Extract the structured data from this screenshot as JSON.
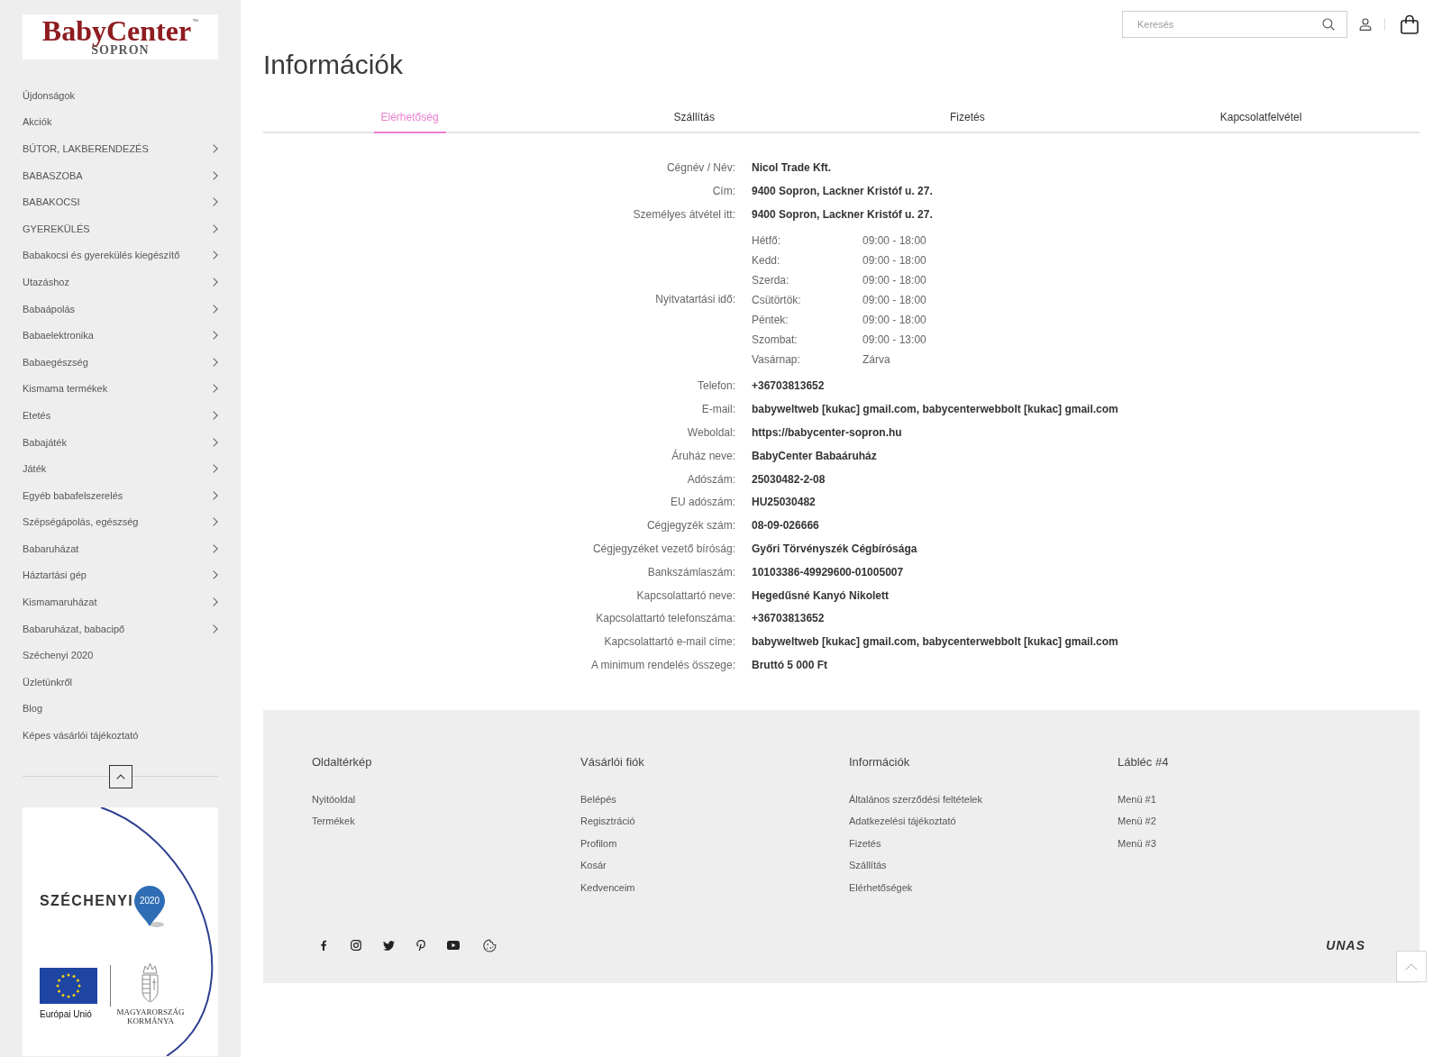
{
  "logo": {
    "brand": "BabyCenter",
    "trademark": "™",
    "city": "SOPRON"
  },
  "sidebar": {
    "items": [
      {
        "label": "Újdonságok",
        "submenu": false
      },
      {
        "label": "Akciók",
        "submenu": false
      },
      {
        "label": "BÚTOR, LAKBERENDEZÉS",
        "submenu": true
      },
      {
        "label": "BABASZOBA",
        "submenu": true
      },
      {
        "label": "BABAKOCSI",
        "submenu": true
      },
      {
        "label": "GYEREKÜLÉS",
        "submenu": true
      },
      {
        "label": "Babakocsi és gyerekülés kiegészítő",
        "submenu": true
      },
      {
        "label": "Utazáshoz",
        "submenu": true
      },
      {
        "label": "Babaápolás",
        "submenu": true
      },
      {
        "label": "Babaelektronika",
        "submenu": true
      },
      {
        "label": "Babaegészség",
        "submenu": true
      },
      {
        "label": "Kismama termékek",
        "submenu": true
      },
      {
        "label": "Etetés",
        "submenu": true
      },
      {
        "label": "Babajáték",
        "submenu": true
      },
      {
        "label": "Játék",
        "submenu": true
      },
      {
        "label": "Egyéb babafelszerelés",
        "submenu": true
      },
      {
        "label": "Szépségápolás, egészség",
        "submenu": true
      },
      {
        "label": "Babaruházat",
        "submenu": true
      },
      {
        "label": "Háztartási gép",
        "submenu": true
      },
      {
        "label": "Kismamaruházat",
        "submenu": true
      },
      {
        "label": "Babaruházat, babacipő",
        "submenu": true
      },
      {
        "label": "Széchenyi 2020",
        "submenu": false
      },
      {
        "label": "Üzletünkről",
        "submenu": false
      },
      {
        "label": "Blog",
        "submenu": false
      },
      {
        "label": "Képes vásárlói tájékoztató",
        "submenu": false
      }
    ]
  },
  "banner": {
    "title": "SZÉCHENYI",
    "year": "2020",
    "eu_label": "Európai Unió",
    "government_label": [
      "MAGYARORSZÁG",
      "KORMÁNYA"
    ]
  },
  "header": {
    "search": {
      "placeholder": "Keresés"
    }
  },
  "page_title": "Információk",
  "tabs": [
    {
      "label": "Elérhetőség",
      "selected": true
    },
    {
      "label": "Szállítás",
      "selected": false
    },
    {
      "label": "Fizetés",
      "selected": false
    },
    {
      "label": "Kapcsolatfelvétel",
      "selected": false
    }
  ],
  "info_rows": [
    {
      "kind": "text",
      "label": "Cégnév / Név:",
      "value": "Nicol Trade Kft."
    },
    {
      "kind": "text",
      "label": "Cím:",
      "value": "9400 Sopron, Lackner Kristóf u. 27."
    },
    {
      "kind": "text",
      "label": "Személyes átvétel itt:",
      "value": "9400 Sopron, Lackner Kristóf u. 27."
    },
    {
      "kind": "hours",
      "label": "Nyitvatartási idő:",
      "hours": [
        {
          "day": "Hétfő:",
          "time": "09:00 - 18:00"
        },
        {
          "day": "Kedd:",
          "time": "09:00 - 18:00"
        },
        {
          "day": "Szerda:",
          "time": "09:00 - 18:00"
        },
        {
          "day": "Csütörtök:",
          "time": "09:00 - 18:00"
        },
        {
          "day": "Péntek:",
          "time": "09:00 - 18:00"
        },
        {
          "day": "Szombat:",
          "time": "09:00 - 13:00"
        },
        {
          "day": "Vasárnap:",
          "time": "Zárva"
        }
      ]
    },
    {
      "kind": "text",
      "label": "Telefon:",
      "value": "+36703813652"
    },
    {
      "kind": "text",
      "label": "E-mail:",
      "value": "babyweltweb [kukac] gmail.com, babycenterwebbolt [kukac] gmail.com"
    },
    {
      "kind": "text",
      "label": "Weboldal:",
      "value": "https://babycenter-sopron.hu"
    },
    {
      "kind": "text",
      "label": "Áruház neve:",
      "value": "BabyCenter Babaáruház"
    },
    {
      "kind": "text",
      "label": "Adószám:",
      "value": "25030482-2-08"
    },
    {
      "kind": "text",
      "label": "EU adószám:",
      "value": "HU25030482"
    },
    {
      "kind": "text",
      "label": "Cégjegyzék szám:",
      "value": "08-09-026666"
    },
    {
      "kind": "text",
      "label": "Cégjegyzéket vezető bíróság:",
      "value": "Győri Törvényszék Cégbírósága"
    },
    {
      "kind": "text",
      "label": "Bankszámlaszám:",
      "value": "10103386-49929600-01005007"
    },
    {
      "kind": "text",
      "label": "Kapcsolattartó neve:",
      "value": "Hegedűsné Kanyó Nikolett"
    },
    {
      "kind": "text",
      "label": "Kapcsolattartó telefonszáma:",
      "value": "+36703813652"
    },
    {
      "kind": "text",
      "label": "Kapcsolattartó e-mail címe:",
      "value": "babyweltweb [kukac] gmail.com, babycenterwebbolt [kukac] gmail.com"
    },
    {
      "kind": "text",
      "label": "A minimum rendelés összege:",
      "value": "Bruttó 5 000 Ft"
    }
  ],
  "footer": {
    "columns": [
      {
        "heading": "Oldaltérkép",
        "links": [
          "Nyitóoldal",
          "Termékek"
        ]
      },
      {
        "heading": "Vásárlói fiók",
        "links": [
          "Belépés",
          "Regisztráció",
          "Profilom",
          "Kosár",
          "Kedvenceim"
        ]
      },
      {
        "heading": "Információk",
        "links": [
          "Általános szerződési feltételek",
          "Adatkezelési tájékoztató",
          "Fizetés",
          "Szállítás",
          "Elérhetőségek"
        ]
      },
      {
        "heading": "Lábléc #4",
        "links": [
          "Menü #1",
          "Menü #2",
          "Menü #3"
        ]
      }
    ],
    "brand": "UNAS"
  }
}
